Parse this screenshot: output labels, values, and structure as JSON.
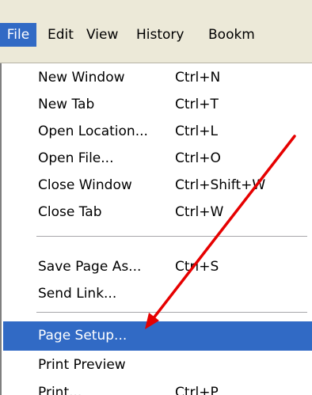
{
  "menubar": {
    "items": [
      {
        "label": "File",
        "mnemonic": "F",
        "active": true
      },
      {
        "label": "Edit",
        "mnemonic": "E"
      },
      {
        "label": "View",
        "mnemonic": "V"
      },
      {
        "label": "History",
        "mnemonic": "s"
      },
      {
        "label": "Bookm",
        "mnemonic": ""
      }
    ]
  },
  "file_menu": {
    "items": [
      {
        "label": "New Window",
        "shortcut": "Ctrl+N"
      },
      {
        "label": "New Tab",
        "shortcut": "Ctrl+T"
      },
      {
        "label": "Open Location...",
        "shortcut": "Ctrl+L"
      },
      {
        "label": "Open File...",
        "shortcut": "Ctrl+O"
      },
      {
        "label": "Close Window",
        "shortcut": "Ctrl+Shift+W"
      },
      {
        "label": "Close Tab",
        "shortcut": "Ctrl+W"
      },
      {
        "label": "Save Page As...",
        "shortcut": "Ctrl+S"
      },
      {
        "label": "Send Link...",
        "shortcut": ""
      },
      {
        "label": "Page Setup...",
        "shortcut": "",
        "highlighted": true
      },
      {
        "label": "Print Preview",
        "shortcut": ""
      },
      {
        "label": "Print...",
        "shortcut": "Ctrl+P"
      }
    ]
  },
  "colors": {
    "highlight": "#316ac5",
    "menubar_bg": "#ece9d8",
    "annotation_arrow": "#e60000"
  },
  "annotation": {
    "type": "arrow",
    "icon": "red-arrow-icon",
    "points_to": "Page Setup..."
  }
}
